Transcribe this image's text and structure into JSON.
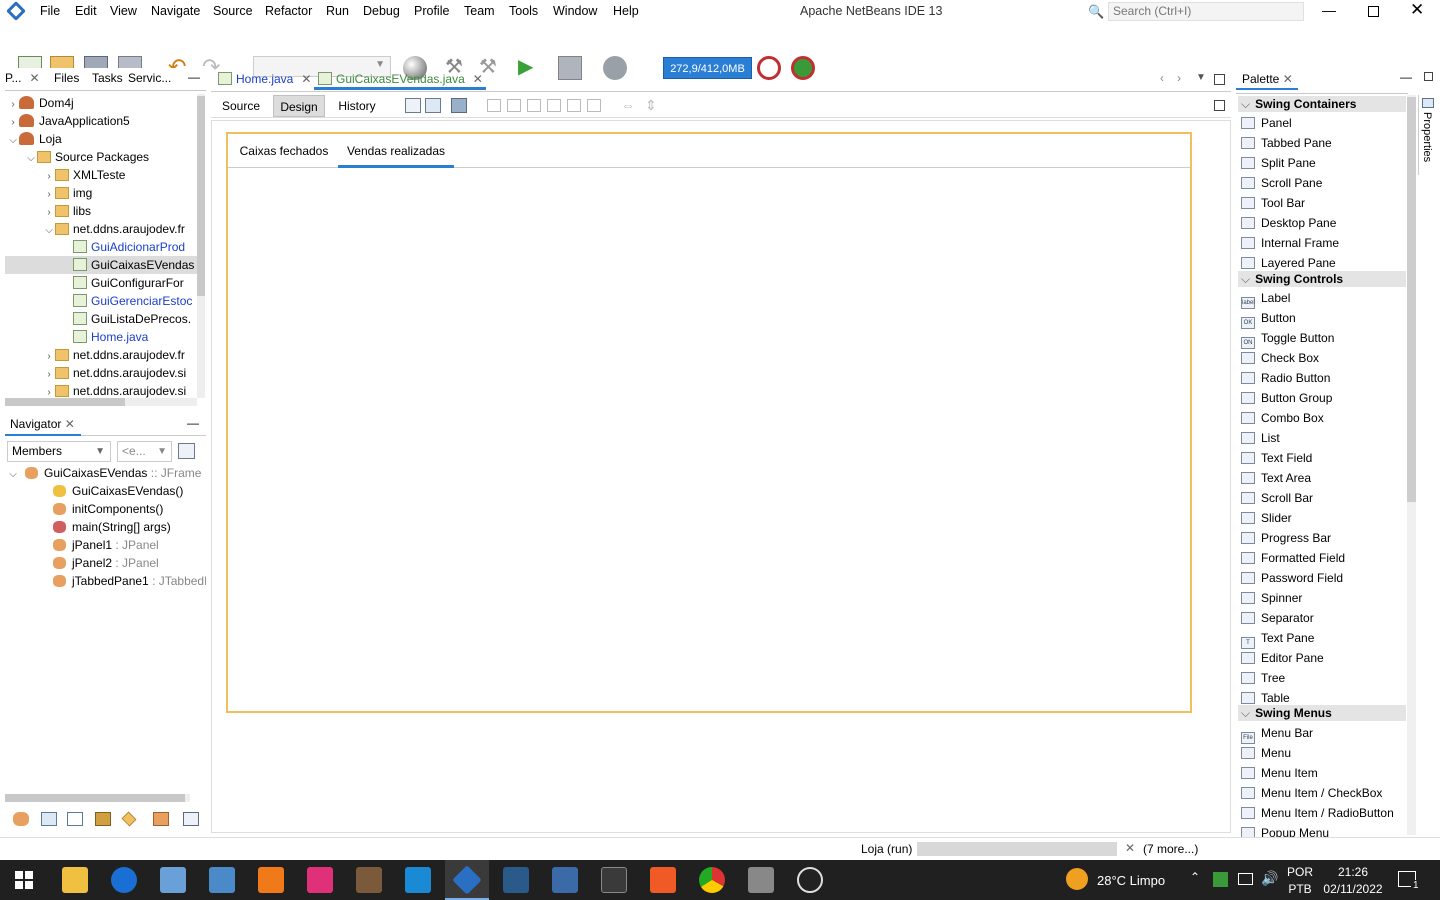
{
  "app": {
    "title": "Apache NetBeans IDE 13",
    "search_placeholder": "Search (Ctrl+I)"
  },
  "menubar": [
    "File",
    "Edit",
    "View",
    "Navigate",
    "Source",
    "Refactor",
    "Run",
    "Debug",
    "Profile",
    "Team",
    "Tools",
    "Window",
    "Help"
  ],
  "toolbar": {
    "memory": "272,9/412,0MB"
  },
  "left_tabs": [
    "P...",
    "Files",
    "Tasks",
    "Servic..."
  ],
  "project_tree": [
    {
      "label": "Dom4j",
      "type": "project"
    },
    {
      "label": "JavaApplication5",
      "type": "project"
    },
    {
      "label": "Loja",
      "type": "project"
    },
    {
      "label": "Source Packages",
      "type": "folder"
    },
    {
      "label": "XMLTeste",
      "type": "package"
    },
    {
      "label": "img",
      "type": "package"
    },
    {
      "label": "libs",
      "type": "package"
    },
    {
      "label": "net.ddns.araujodev.fr",
      "type": "package"
    },
    {
      "label": "GuiAdicionarProd",
      "type": "file",
      "link": true
    },
    {
      "label": "GuiCaixasEVendas",
      "type": "file",
      "selected": true
    },
    {
      "label": "GuiConfigurarFor",
      "type": "file"
    },
    {
      "label": "GuiGerenciarEstoc",
      "type": "file",
      "link": true
    },
    {
      "label": "GuiListaDePrecos.",
      "type": "file"
    },
    {
      "label": "Home.java",
      "type": "file",
      "link": true
    },
    {
      "label": "net.ddns.araujodev.fr",
      "type": "package"
    },
    {
      "label": "net.ddns.araujodev.si",
      "type": "package"
    },
    {
      "label": "net.ddns.araujodev.si",
      "type": "package"
    }
  ],
  "navigator": {
    "title": "Navigator",
    "filter": "Members",
    "filter2": "<e...",
    "items": [
      {
        "name": "GuiCaixasEVendas",
        "suffix": " :: JFrame"
      },
      {
        "name": "GuiCaixasEVendas()",
        "suffix": ""
      },
      {
        "name": "initComponents()",
        "suffix": ""
      },
      {
        "name": "main(String[] args)",
        "suffix": ""
      },
      {
        "name": "jPanel1",
        "suffix": " : JPanel"
      },
      {
        "name": "jPanel2",
        "suffix": " : JPanel"
      },
      {
        "name": "jTabbedPane1",
        "suffix": " : JTabbedPa"
      }
    ]
  },
  "editor_tabs": [
    {
      "label": "Home.java",
      "active": false
    },
    {
      "label": "GuiCaixasEVendas.java",
      "active": true
    }
  ],
  "editor_views": [
    "Source",
    "Design",
    "History"
  ],
  "form_tabs": [
    "Caixas fechados",
    "Vendas realizadas"
  ],
  "palette": {
    "title": "Palette",
    "properties_label": "Properties",
    "categories": [
      {
        "name": "Swing Containers",
        "items": [
          "Panel",
          "Tabbed Pane",
          "Split Pane",
          "Scroll Pane",
          "Tool Bar",
          "Desktop Pane",
          "Internal Frame",
          "Layered Pane"
        ]
      },
      {
        "name": "Swing Controls",
        "items": [
          "Label",
          "Button",
          "Toggle Button",
          "Check Box",
          "Radio Button",
          "Button Group",
          "Combo Box",
          "List",
          "Text Field",
          "Text Area",
          "Scroll Bar",
          "Slider",
          "Progress Bar",
          "Formatted Field",
          "Password Field",
          "Spinner",
          "Separator",
          "Text Pane",
          "Editor Pane",
          "Tree",
          "Table"
        ]
      },
      {
        "name": "Swing Menus",
        "items": [
          "Menu Bar",
          "Menu",
          "Menu Item",
          "Menu Item / CheckBox",
          "Menu Item / RadioButton",
          "Popup Menu"
        ]
      }
    ]
  },
  "statusbar": {
    "task": "Loja (run)",
    "more": "(7 more...)"
  },
  "taskbar": {
    "weather": "28°C  Limpo",
    "lang1": "POR",
    "lang2": "PTB",
    "time": "21:26",
    "date": "02/11/2022",
    "notifications": "1"
  }
}
